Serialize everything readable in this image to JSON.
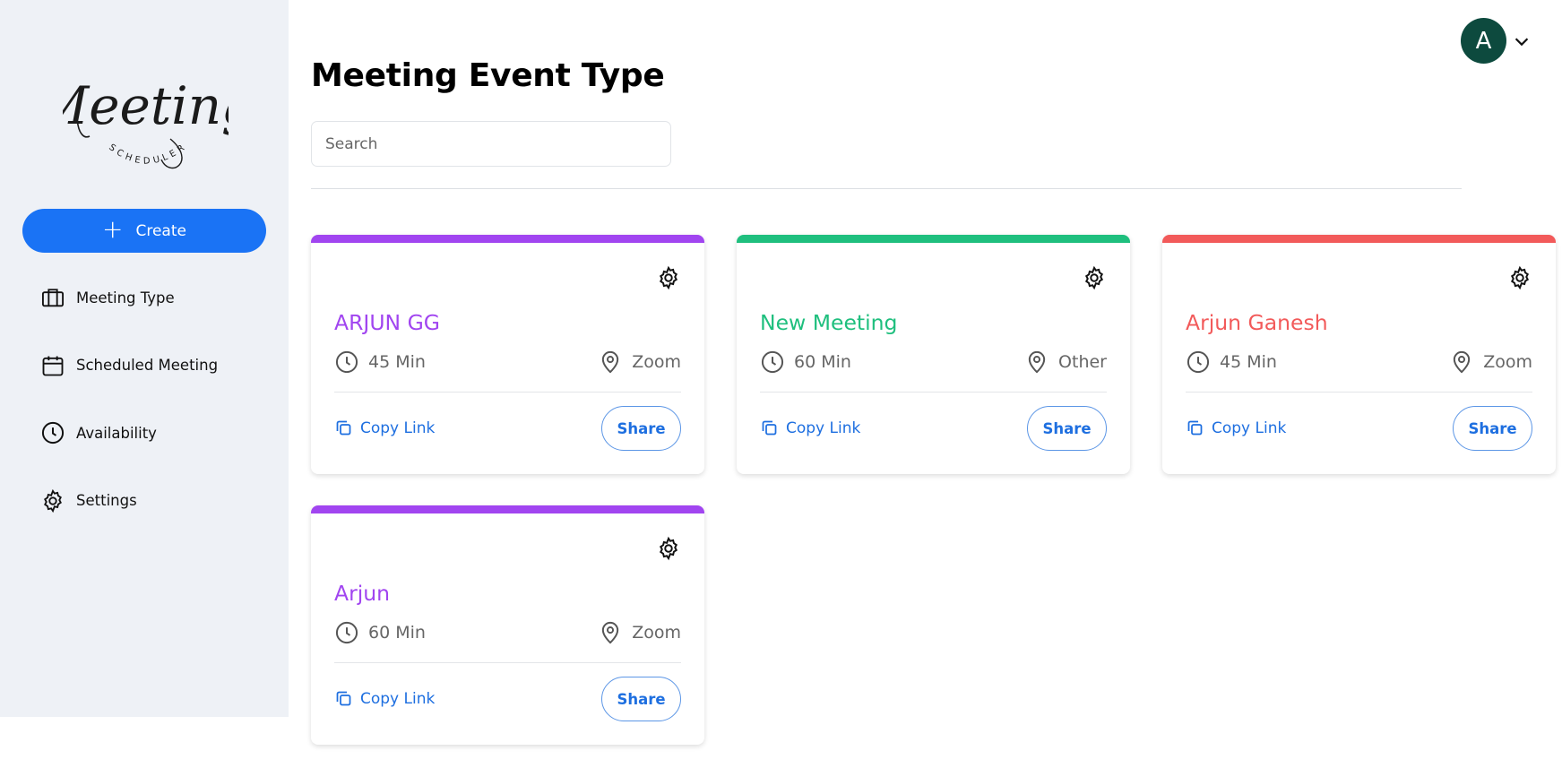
{
  "sidebar": {
    "logo": {
      "word": "Meeting",
      "subword": "SCHEDULER"
    },
    "create_label": "Create",
    "items": [
      {
        "label": "Meeting Type",
        "icon": "briefcase-icon"
      },
      {
        "label": "Scheduled Meeting",
        "icon": "calendar-icon"
      },
      {
        "label": "Availability",
        "icon": "clock-icon"
      },
      {
        "label": "Settings",
        "icon": "gear-icon"
      }
    ]
  },
  "header": {
    "avatar_initial": "A",
    "avatar_color": "#0d4a3e"
  },
  "main": {
    "title": "Meeting Event Type",
    "search_placeholder": "Search",
    "cards": [
      {
        "name": "ARJUN GG",
        "duration": "45 Min",
        "location": "Zoom",
        "color": "#a145f0",
        "copy_label": "Copy Link",
        "share_label": "Share"
      },
      {
        "name": "New Meeting",
        "duration": "60 Min",
        "location": "Other",
        "color": "#1fbf7e",
        "copy_label": "Copy Link",
        "share_label": "Share"
      },
      {
        "name": "Arjun Ganesh",
        "duration": "45 Min",
        "location": "Zoom",
        "color": "#f25a5a",
        "copy_label": "Copy Link",
        "share_label": "Share"
      },
      {
        "name": "Arjun",
        "duration": "60 Min",
        "location": "Zoom",
        "color": "#a145f0",
        "copy_label": "Copy Link",
        "share_label": "Share"
      }
    ]
  },
  "colors": {
    "accent": "#1a73f5",
    "link": "#1e6fe0",
    "sidebar_bg": "#eef1f6"
  }
}
